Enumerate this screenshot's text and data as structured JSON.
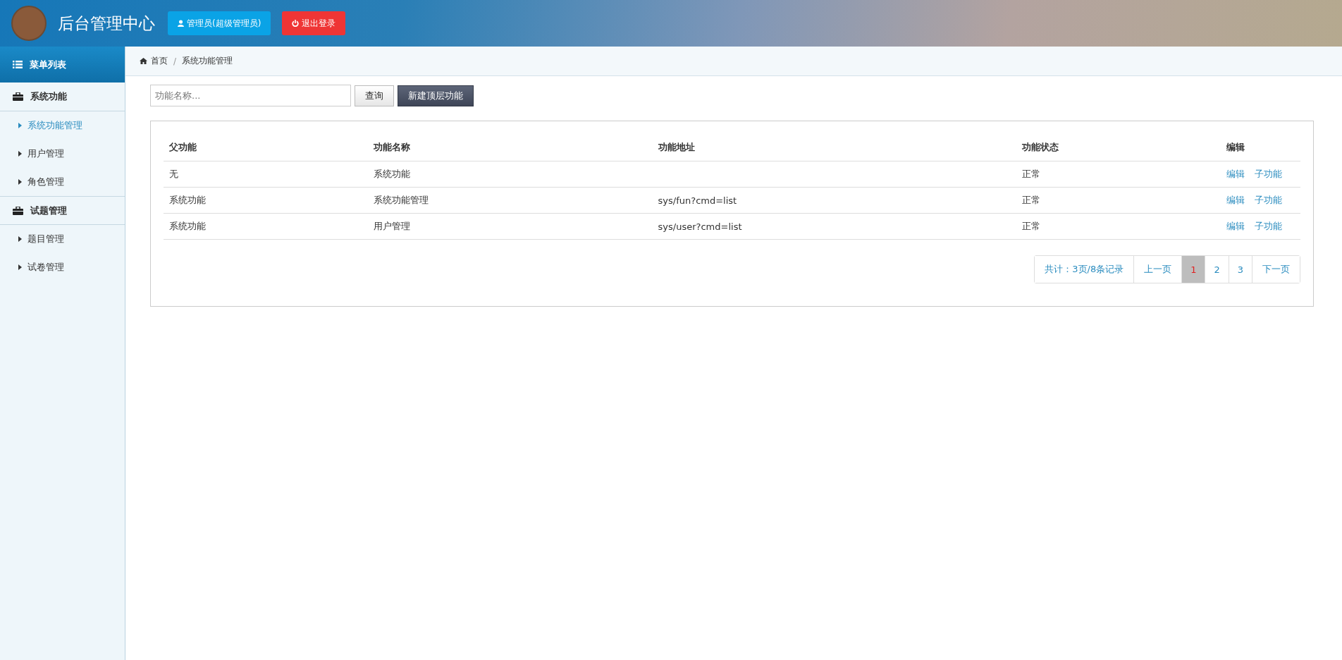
{
  "header": {
    "title": "后台管理中心",
    "user_button": "管理员(超级管理员)",
    "logout_button": "退出登录"
  },
  "sidebar": {
    "title": "菜单列表",
    "groups": [
      {
        "label": "系统功能",
        "items": [
          {
            "label": "系统功能管理",
            "selected": true
          },
          {
            "label": "用户管理",
            "selected": false
          },
          {
            "label": "角色管理",
            "selected": false
          }
        ]
      },
      {
        "label": "试题管理",
        "items": [
          {
            "label": "题目管理",
            "selected": false
          },
          {
            "label": "试卷管理",
            "selected": false
          }
        ]
      }
    ]
  },
  "breadcrumb": {
    "separator": "/",
    "items": [
      "首页",
      "系统功能管理"
    ]
  },
  "toolbar": {
    "search_placeholder": "功能名称...",
    "query_button": "查询",
    "new_button": "新建顶层功能"
  },
  "table": {
    "columns": [
      "父功能",
      "功能名称",
      "功能地址",
      "功能状态",
      "编辑"
    ],
    "rows": [
      {
        "cells": [
          "无",
          "系统功能",
          "",
          "正常"
        ],
        "actions": [
          "编辑",
          "子功能"
        ]
      },
      {
        "cells": [
          "系统功能",
          "系统功能管理",
          "sys/fun?cmd=list",
          "正常"
        ],
        "actions": [
          "编辑",
          "子功能"
        ]
      },
      {
        "cells": [
          "系统功能",
          "用户管理",
          "sys/user?cmd=list",
          "正常"
        ],
        "actions": [
          "编辑",
          "子功能"
        ]
      }
    ]
  },
  "pagination": {
    "summary": "共计：3页/8条记录",
    "prev": "上一页",
    "pages": [
      {
        "label": "1",
        "selected": true
      },
      {
        "label": "2",
        "selected": false
      },
      {
        "label": "3",
        "selected": false
      }
    ],
    "next": "下一页"
  }
}
